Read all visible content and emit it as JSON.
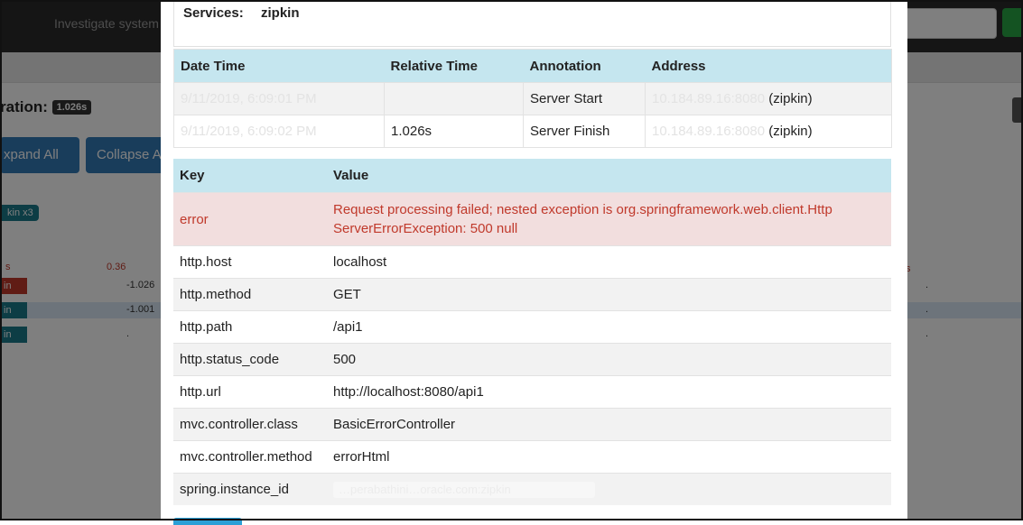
{
  "background": {
    "search_hint": "Investigate system",
    "duration_label": "ration:",
    "duration_value": "1.026s",
    "expand_all_label": "xpand All",
    "collapse_label": "Collapse A",
    "service_badge": "kin x3",
    "timeline_tick_left": "s",
    "timeline_tick_value": "0.36",
    "timeline_tick_right": "s",
    "span_rows": [
      {
        "label": "in",
        "color": "#c0392b",
        "value": "-1.026",
        "selected": false
      },
      {
        "label": "in",
        "color": "#1a7a8a",
        "value": "-1.001",
        "selected": true
      },
      {
        "label": "in",
        "color": "#1a7a8a",
        "value": ".",
        "selected": false
      }
    ]
  },
  "modal": {
    "services_label": "Services:",
    "services_value": "zipkin",
    "annotations": {
      "headers": [
        "Date Time",
        "Relative Time",
        "Annotation",
        "Address"
      ],
      "rows": [
        {
          "datetime": "9/11/2019, 6:09:01 PM",
          "relative": "",
          "annotation": "Server Start",
          "address_ip": "10.184.89.16:8080",
          "address_service": "(zipkin)"
        },
        {
          "datetime": "9/11/2019, 6:09:02 PM",
          "relative": "1.026s",
          "annotation": "Server Finish",
          "address_ip": "10.184.89.16:8080",
          "address_service": "(zipkin)"
        }
      ]
    },
    "tags": {
      "headers": [
        "Key",
        "Value"
      ],
      "rows": [
        {
          "key": "error",
          "value": "Request processing failed; nested exception is org.springframework.web.client.Http ServerErrorException: 500 null",
          "error": true
        },
        {
          "key": "http.host",
          "value": "localhost"
        },
        {
          "key": "http.method",
          "value": "GET"
        },
        {
          "key": "http.path",
          "value": "/api1"
        },
        {
          "key": "http.status_code",
          "value": "500"
        },
        {
          "key": "http.url",
          "value": "http://localhost:8080/api1"
        },
        {
          "key": "mvc.controller.class",
          "value": "BasicErrorController"
        },
        {
          "key": "mvc.controller.method",
          "value": "errorHtml"
        },
        {
          "key": "spring.instance_id",
          "value": "…perabathini…oracle.com:zipkin",
          "redacted": true
        }
      ]
    }
  }
}
